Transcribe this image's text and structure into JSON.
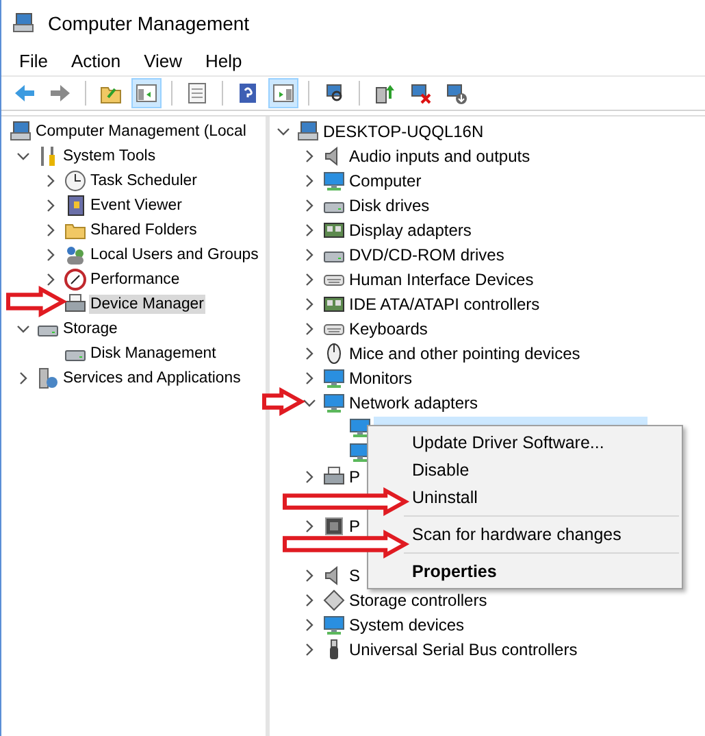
{
  "window": {
    "title": "Computer Management"
  },
  "menu_bar": [
    {
      "label": "File"
    },
    {
      "label": "Action"
    },
    {
      "label": "View"
    },
    {
      "label": "Help"
    }
  ],
  "toolbar_groups": [
    {
      "buttons": [
        {
          "pressed": false
        },
        {
          "pressed": false
        }
      ]
    },
    {
      "buttons": [
        {
          "pressed": false
        },
        {
          "pressed": true
        }
      ]
    },
    {
      "buttons": [
        {
          "pressed": false
        }
      ]
    },
    {
      "buttons": [
        {
          "pressed": false
        },
        {
          "pressed": true
        }
      ]
    },
    {
      "buttons": [
        {
          "pressed": false
        }
      ]
    },
    {
      "buttons": [
        {
          "pressed": false
        },
        {
          "pressed": false
        },
        {
          "pressed": false
        }
      ]
    }
  ],
  "console_tree": [
    {
      "label": "Computer Management (Local",
      "selected": false,
      "children": [
        {
          "label": "System Tools",
          "expanded": true,
          "selected": false,
          "children": [
            {
              "label": "Task Scheduler",
              "expanded": false,
              "selected": false
            },
            {
              "label": "Event Viewer",
              "expanded": false,
              "selected": false
            },
            {
              "label": "Shared Folders",
              "expanded": false,
              "selected": false
            },
            {
              "label": "Local Users and Groups",
              "expanded": false,
              "selected": false
            },
            {
              "label": "Performance",
              "expanded": false,
              "selected": false
            },
            {
              "label": "Device Manager",
              "selected": true
            }
          ]
        },
        {
          "label": "Storage",
          "expanded": true,
          "selected": false,
          "children": [
            {
              "label": "Disk Management",
              "selected": false
            }
          ]
        },
        {
          "label": "Services and Applications",
          "expanded": false,
          "selected": false
        }
      ]
    }
  ],
  "device_tree": [
    {
      "label": "DESKTOP-UQQL16N",
      "expanded": true,
      "selected": false,
      "children": [
        {
          "label": "Audio inputs and outputs",
          "expanded": false,
          "selected": false
        },
        {
          "label": "Computer",
          "expanded": false,
          "selected": false
        },
        {
          "label": "Disk drives",
          "expanded": false,
          "selected": false
        },
        {
          "label": "Display adapters",
          "expanded": false,
          "selected": false
        },
        {
          "label": "DVD/CD-ROM drives",
          "expanded": false,
          "selected": false
        },
        {
          "label": "Human Interface Devices",
          "expanded": false,
          "selected": false
        },
        {
          "label": "IDE ATA/ATAPI controllers",
          "expanded": false,
          "selected": false
        },
        {
          "label": "Keyboards",
          "expanded": false,
          "selected": false
        },
        {
          "label": "Mice and other pointing devices",
          "expanded": false,
          "selected": false
        },
        {
          "label": "Monitors",
          "expanded": false,
          "selected": false
        },
        {
          "label": "Network adapters",
          "expanded": true,
          "selected": false,
          "children": [
            {
              "selected": true
            },
            {
              "selected": false
            }
          ]
        },
        {
          "label": "P",
          "expanded": false,
          "selected": false
        },
        {
          "selected": false
        },
        {
          "label": "P",
          "expanded": false,
          "selected": false
        },
        {
          "selected": false
        },
        {
          "label": "S",
          "expanded": false,
          "selected": false
        },
        {
          "label": "Storage controllers",
          "expanded": false,
          "selected": false
        },
        {
          "label": "System devices",
          "expanded": false,
          "selected": false
        },
        {
          "label": "Universal Serial Bus controllers",
          "expanded": false,
          "selected": false
        }
      ]
    }
  ],
  "context_menu": {
    "items": [
      {
        "kind": "item",
        "label": "Update Driver Software...",
        "default": false
      },
      {
        "kind": "item",
        "label": "Disable",
        "default": false
      },
      {
        "kind": "item",
        "label": "Uninstall",
        "default": false
      },
      {
        "kind": "separator"
      },
      {
        "kind": "item",
        "label": "Scan for hardware changes",
        "default": false
      },
      {
        "kind": "separator"
      },
      {
        "kind": "item",
        "label": "Properties",
        "default": true
      }
    ]
  }
}
